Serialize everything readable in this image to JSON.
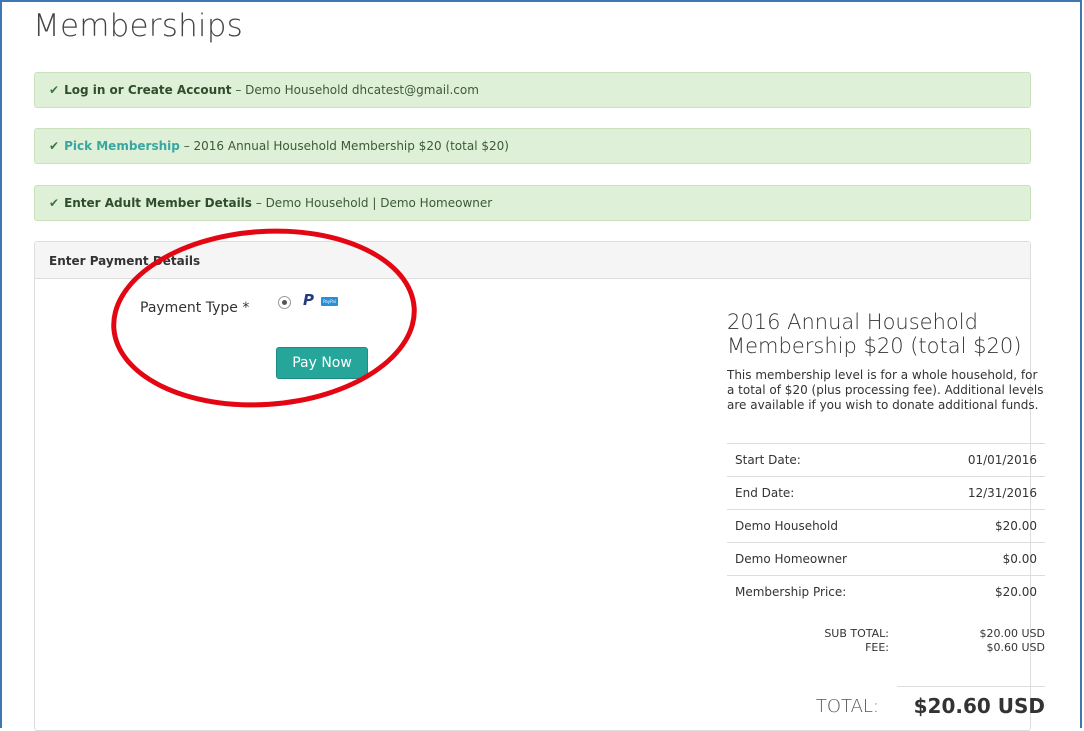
{
  "page": {
    "title": "Memberships"
  },
  "steps": [
    {
      "title": "Log in or Create Account",
      "detail": " – Demo Household dhcatest@gmail.com"
    },
    {
      "title": "Pick Membership",
      "detail": " – 2016 Annual Household Membership $20 (total $20)"
    },
    {
      "title": "Enter Adult Member Details",
      "detail": " – Demo Household | Demo Homeowner"
    }
  ],
  "payment": {
    "heading": "Enter Payment Details",
    "type_label": "Payment Type *",
    "paypal_glyph": "P",
    "paypal_badge": "PayPal",
    "pay_button": "Pay Now"
  },
  "summary": {
    "title": "2016 Annual Household Membership $20 (total $20)",
    "description": "This membership level is for a whole household, for a total of $20 (plus processing fee).  Additional levels are available if you wish to donate additional funds.",
    "rows": [
      {
        "label": "Start Date:",
        "value": "01/01/2016"
      },
      {
        "label": "End Date:",
        "value": "12/31/2016"
      },
      {
        "label": "Demo Household",
        "value": "$20.00"
      },
      {
        "label": "Demo Homeowner",
        "value": "$0.00"
      },
      {
        "label": "Membership Price:",
        "value": "$20.00"
      }
    ],
    "subtotal_label": "SUB TOTAL:",
    "subtotal_value": "$20.00 USD",
    "fee_label": "FEE:",
    "fee_value": "$0.60 USD",
    "total_label": "TOTAL:",
    "total_value": "$20.60 USD"
  },
  "colors": {
    "accent_button": "#26a69a",
    "step_background": "#dff0d8",
    "annotation": "#e30613",
    "window_border": "#3d78b5"
  },
  "icons": {
    "check": "check-icon",
    "paypal": "paypal-icon"
  }
}
